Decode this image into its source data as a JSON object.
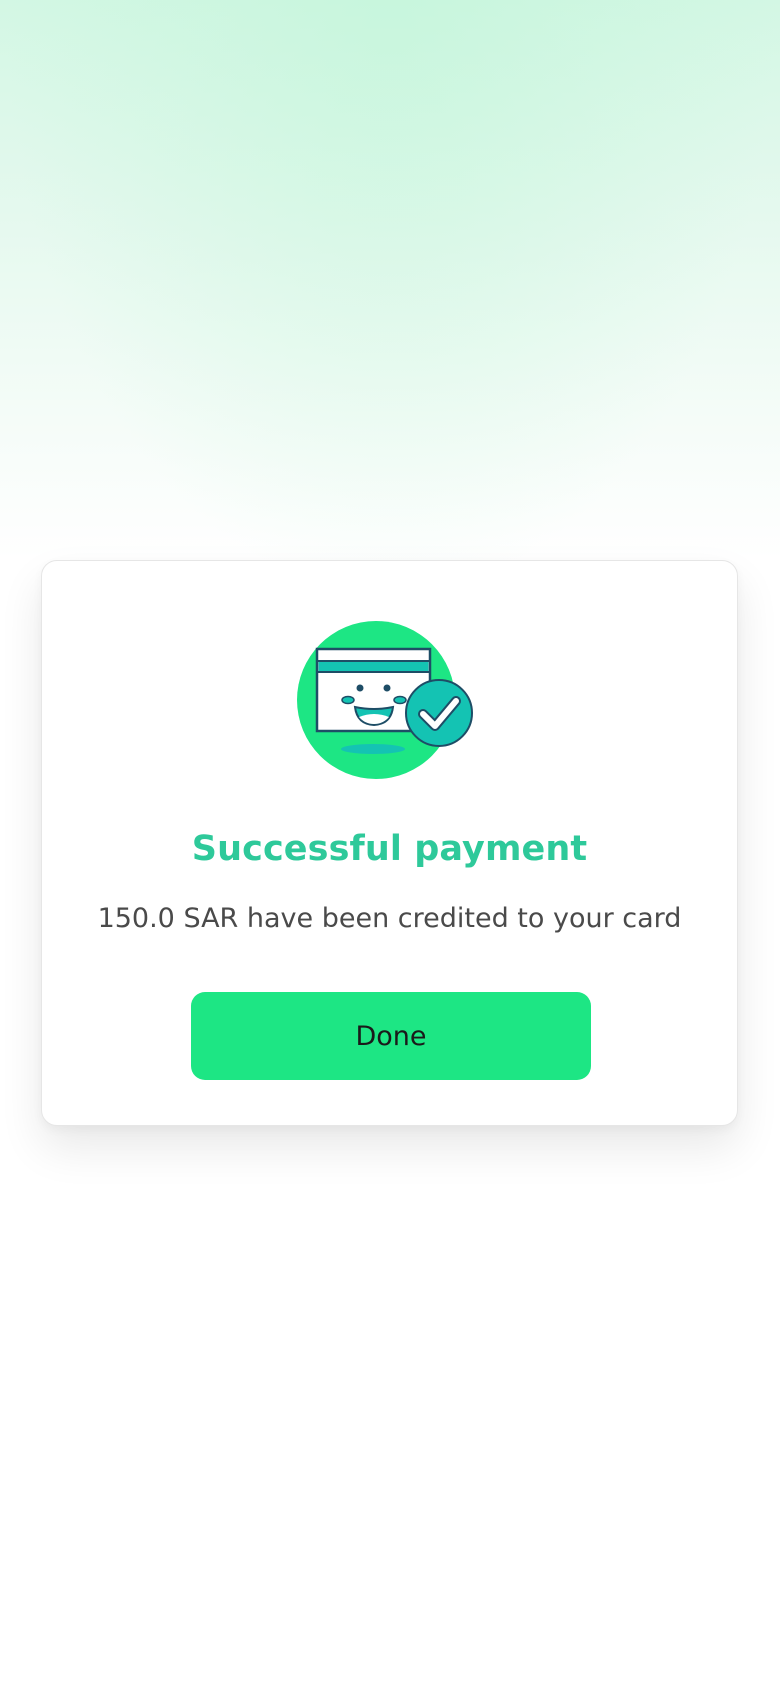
{
  "dialog": {
    "title": "Successful payment",
    "message": "150.0 SAR have been credited to your card",
    "done_label": "Done",
    "illustration_icon": "smiling-card-check-icon"
  },
  "colors": {
    "accent": "#1de684",
    "title": "#2ec99a",
    "teal": "#14c3b3",
    "outline": "#1e4d66"
  }
}
